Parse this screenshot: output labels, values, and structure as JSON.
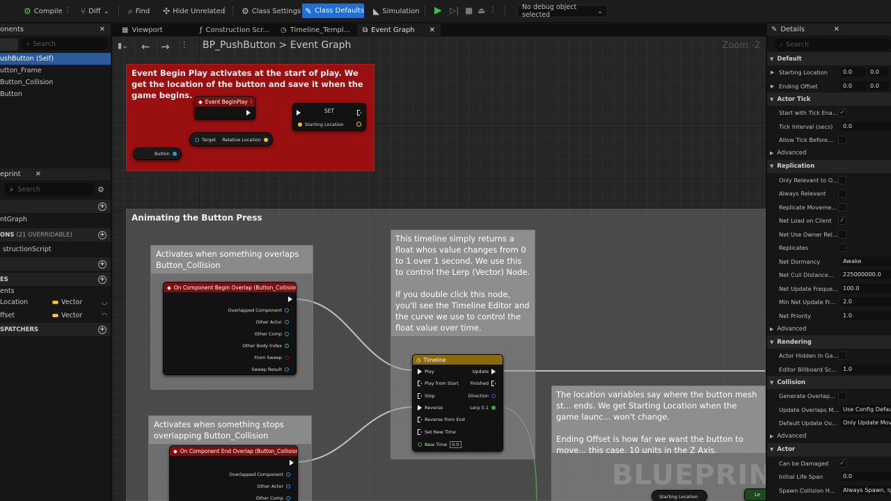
{
  "toolbar": {
    "compile": "Compile",
    "diff": "Diff",
    "find": "Find",
    "hide_unrelated": "Hide Unrelated",
    "class_settings": "Class Settings",
    "class_defaults": "Class Defaults",
    "simulation": "Simulation",
    "debug_object": "No debug object selected"
  },
  "left": {
    "components_tab": "onents",
    "search_placeholder": "Search",
    "components": [
      "ushButton (Self)",
      "utton_Frame",
      "Button_Collision",
      "Button"
    ],
    "blueprint_tab": "eprint",
    "search2_placeholder": "Search",
    "graph_item": "ntGraph",
    "functions_header": "ONS",
    "functions_count": "(21 OVERRIDABLE)",
    "construction_item": "structionScript",
    "variables_header": "ES",
    "variables_group": "ents",
    "variables": [
      {
        "name": "Location",
        "type": "Vector"
      },
      {
        "name": "ffset",
        "type": "Vector"
      }
    ],
    "dispatchers_header": "SPATCHERS"
  },
  "tabs": [
    "Viewport",
    "Construction Scr...",
    "Timeline_Templ...",
    "Event Graph"
  ],
  "graph": {
    "crumb_root": "BP_PushButton",
    "crumb_sep": ">",
    "crumb_leaf": "Event Graph",
    "zoom": "Zoom -2",
    "comment1": "Event Begin Play activates at the start of play. We get the location of the button and save it when the game begins.",
    "event_begin": "Event BeginPlay",
    "set_title": "SET",
    "starting_location": "Starting Location",
    "target": "Target",
    "relative_location": "Relative Location",
    "button": "Button",
    "comment2": "Animating the Button Press",
    "comment3": "Activates when something overlaps Button_Collision",
    "overlap_node": "On Component Begin Overlap (Button_Collision)",
    "overlap_pins": [
      "Overlapped Component",
      "Other Actor",
      "Other Comp",
      "Other Body Index",
      "From Sweep",
      "Sweep Result"
    ],
    "timeline_note": "This timeline simply returns a float whos value changes from 0 to 1 over 1 second. We use this to control the Lerp (Vector) Node.\n\nIf you double click this node, you'll see the Timeline Editor and the curve we use to control the float value over time.",
    "timeline_title": "Timeline",
    "timeline_inputs": [
      "Play",
      "Play from Start",
      "Stop",
      "Reverse",
      "Reverse from End",
      "Set New Time",
      "New Time"
    ],
    "new_time_value": "0.0",
    "timeline_outputs": [
      "Update",
      "Finished",
      "Direction",
      "Lerp 0.1"
    ],
    "comment4": "Activates when something stops overlapping Button_Collision",
    "end_overlap_node": "On Component End Overlap (Button_Collision)",
    "end_overlap_pins": [
      "Overlapped Component",
      "Other Actor",
      "Other Comp"
    ],
    "location_note": "The location variables say where the button mesh st... ends. We get Starting Location when the game launc... won't change.\n\nEnding Offset is how far we want the button to move... this case, 10 units in the Z Axis.",
    "bottom_starting_location": "Starting Location",
    "bottom_lerp": "Le",
    "watermark": "BLUEPRINT"
  },
  "details": {
    "tab": "Details",
    "search_placeholder": "Search",
    "sections": [
      {
        "title": "Default",
        "rows": [
          {
            "label": "Starting Location",
            "values": [
              "0.0",
              "0.0"
            ],
            "caret": true
          },
          {
            "label": "Ending Offset",
            "values": [
              "0.0",
              "0.0"
            ],
            "caret": true
          }
        ]
      },
      {
        "title": "Actor Tick",
        "rows": [
          {
            "label": "Start with Tick Ena...",
            "check": true
          },
          {
            "label": "Tick Interval (secs)",
            "value": "0.0"
          },
          {
            "label": "Allow Tick Before...",
            "check": false
          }
        ],
        "advanced": "Advanced"
      },
      {
        "title": "Replication",
        "rows": [
          {
            "label": "Only Relevant to O...",
            "check": false
          },
          {
            "label": "Always Relevant",
            "check": false
          },
          {
            "label": "Replicate Moveme...",
            "check": false
          },
          {
            "label": "Net Load on Client",
            "check": true
          },
          {
            "label": "Net Use Owner Rel...",
            "check": false
          },
          {
            "label": "Replicates",
            "check": false
          },
          {
            "label": "Net Dormancy",
            "value": "Awake"
          },
          {
            "label": "Net Cull Distance...",
            "value": "225000000.0"
          },
          {
            "label": "Net Update Freque...",
            "value": "100.0"
          },
          {
            "label": "Min Net Update Fr...",
            "value": "2.0"
          },
          {
            "label": "Net Priority",
            "value": "1.0"
          }
        ],
        "advanced": "Advanced"
      },
      {
        "title": "Rendering",
        "rows": [
          {
            "label": "Actor Hidden In Ga...",
            "check": false
          },
          {
            "label": "Editor Billboard Sc...",
            "value": "1.0"
          }
        ]
      },
      {
        "title": "Collision",
        "rows": [
          {
            "label": "Generate Overlap...",
            "check": false
          },
          {
            "label": "Update Overlaps M...",
            "value": "Use Config Default"
          },
          {
            "label": "Default Update Ov...",
            "value": "Only Update Movable"
          }
        ],
        "advanced": "Advanced"
      },
      {
        "title": "Actor",
        "rows": [
          {
            "label": "Can be Damaged",
            "check": true
          },
          {
            "label": "Initial Life Span",
            "value": "0.0"
          },
          {
            "label": "Spawn Collision H...",
            "value": "Always Spawn, Ign..."
          }
        ]
      }
    ]
  }
}
